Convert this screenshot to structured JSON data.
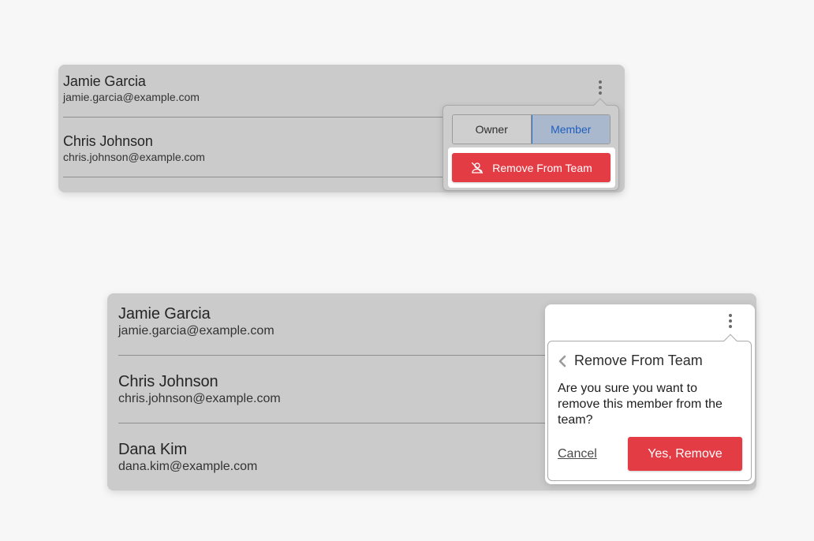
{
  "scene1": {
    "members": [
      {
        "name": "Jamie Garcia",
        "email": "jamie.garcia@example.com"
      },
      {
        "name": "Chris Johnson",
        "email": "chris.johnson@example.com"
      }
    ],
    "popover": {
      "role_options": [
        "Owner",
        "Member"
      ],
      "selected_role": "Member",
      "remove_label": "Remove From Team",
      "remove_icon": "user-remove-icon"
    }
  },
  "scene2": {
    "members": [
      {
        "name": "Jamie Garcia",
        "email": "jamie.garcia@example.com"
      },
      {
        "name": "Chris Johnson",
        "email": "chris.johnson@example.com"
      },
      {
        "name": "Dana Kim",
        "email": "dana.kim@example.com"
      }
    ],
    "confirm": {
      "title": "Remove From Team",
      "message": "Are you sure you want to remove this member from the team?",
      "cancel_label": "Cancel",
      "confirm_label": "Yes, Remove"
    }
  },
  "colors": {
    "background": "#f7f7f7",
    "panel": "#cbcbcb",
    "danger": "#e43c45",
    "selected_text": "#1f5fbf",
    "selected_bg": "#a9b8cc"
  }
}
